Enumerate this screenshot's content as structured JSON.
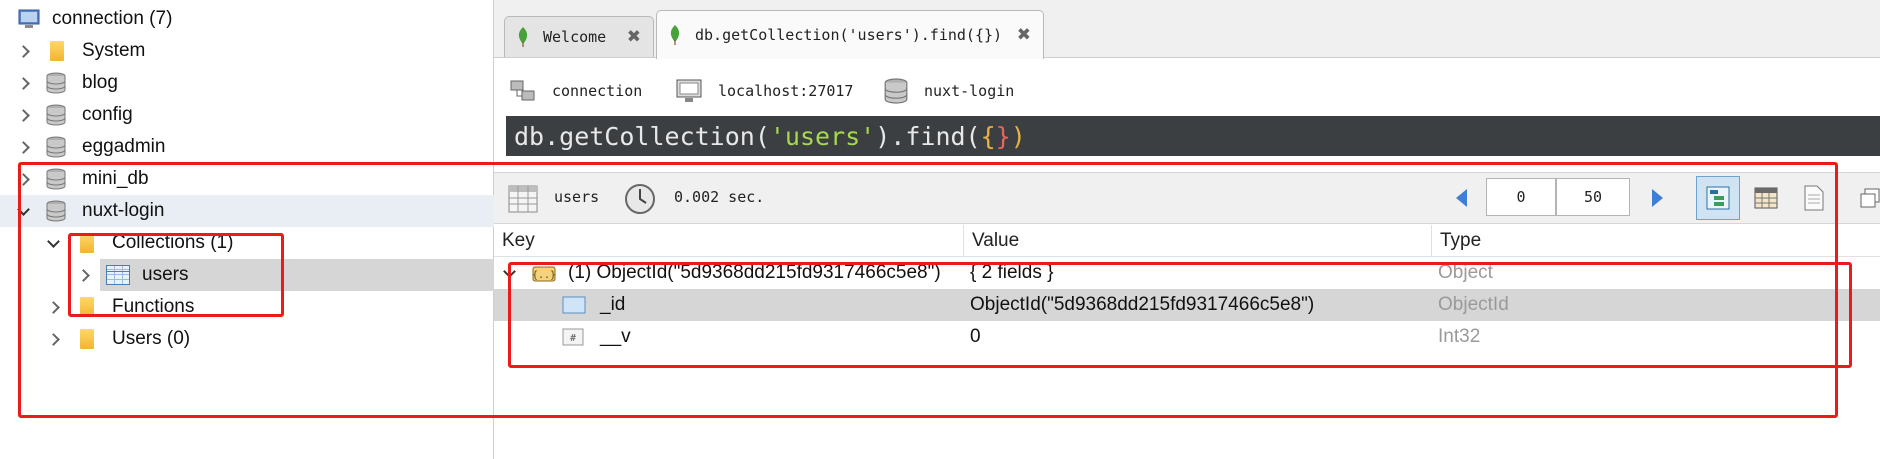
{
  "sidebar": {
    "connection": {
      "label": "connection (7)",
      "icon": "computer-icon"
    },
    "databases": [
      {
        "label": "System",
        "icon": "folder-icon"
      },
      {
        "label": "blog",
        "icon": "database-icon"
      },
      {
        "label": "config",
        "icon": "database-icon"
      },
      {
        "label": "eggadmin",
        "icon": "database-icon"
      },
      {
        "label": "mini_db",
        "icon": "database-icon"
      },
      {
        "label": "nuxt-login",
        "icon": "database-icon"
      }
    ],
    "nuxt_children": {
      "collections": "Collections (1)",
      "users": "users",
      "functions": "Functions",
      "users_group": "Users (0)"
    }
  },
  "tabs": [
    {
      "label": "Welcome",
      "icon": "leaf-icon",
      "active": false
    },
    {
      "label": "db.getCollection('users').find({})",
      "icon": "leaf-icon",
      "active": true
    }
  ],
  "conn_info": {
    "connection": "connection",
    "host": "localhost:27017",
    "database": "nuxt-login"
  },
  "query": {
    "prefix": "db.getCollection(",
    "collection": "'users'",
    "suffix": ").find(",
    "brace_open": "{",
    "brace_close": "}",
    "end": ")"
  },
  "results": {
    "collection": "users",
    "time": "0.002 sec.",
    "page_start": "0",
    "page_size": "50"
  },
  "grid": {
    "columns": [
      "Key",
      "Value",
      "Type"
    ],
    "rows": [
      {
        "key": "(1) ObjectId(\"5d9368dd215fd9317466c5e8\")",
        "value": "{ 2 fields }",
        "type": "Object",
        "icon": "object-icon"
      },
      {
        "key": "_id",
        "value": "ObjectId(\"5d9368dd215fd9317466c5e8\")",
        "type": "ObjectId",
        "icon": "objectid-icon"
      },
      {
        "key": "__v",
        "value": "0",
        "type": "Int32",
        "icon": "int-icon"
      }
    ]
  },
  "colors": {
    "annotation": "#ec1b1b",
    "query_bg": "#3b3f42",
    "query_string": "#a6d94c",
    "selection": "#d6d6d6"
  }
}
